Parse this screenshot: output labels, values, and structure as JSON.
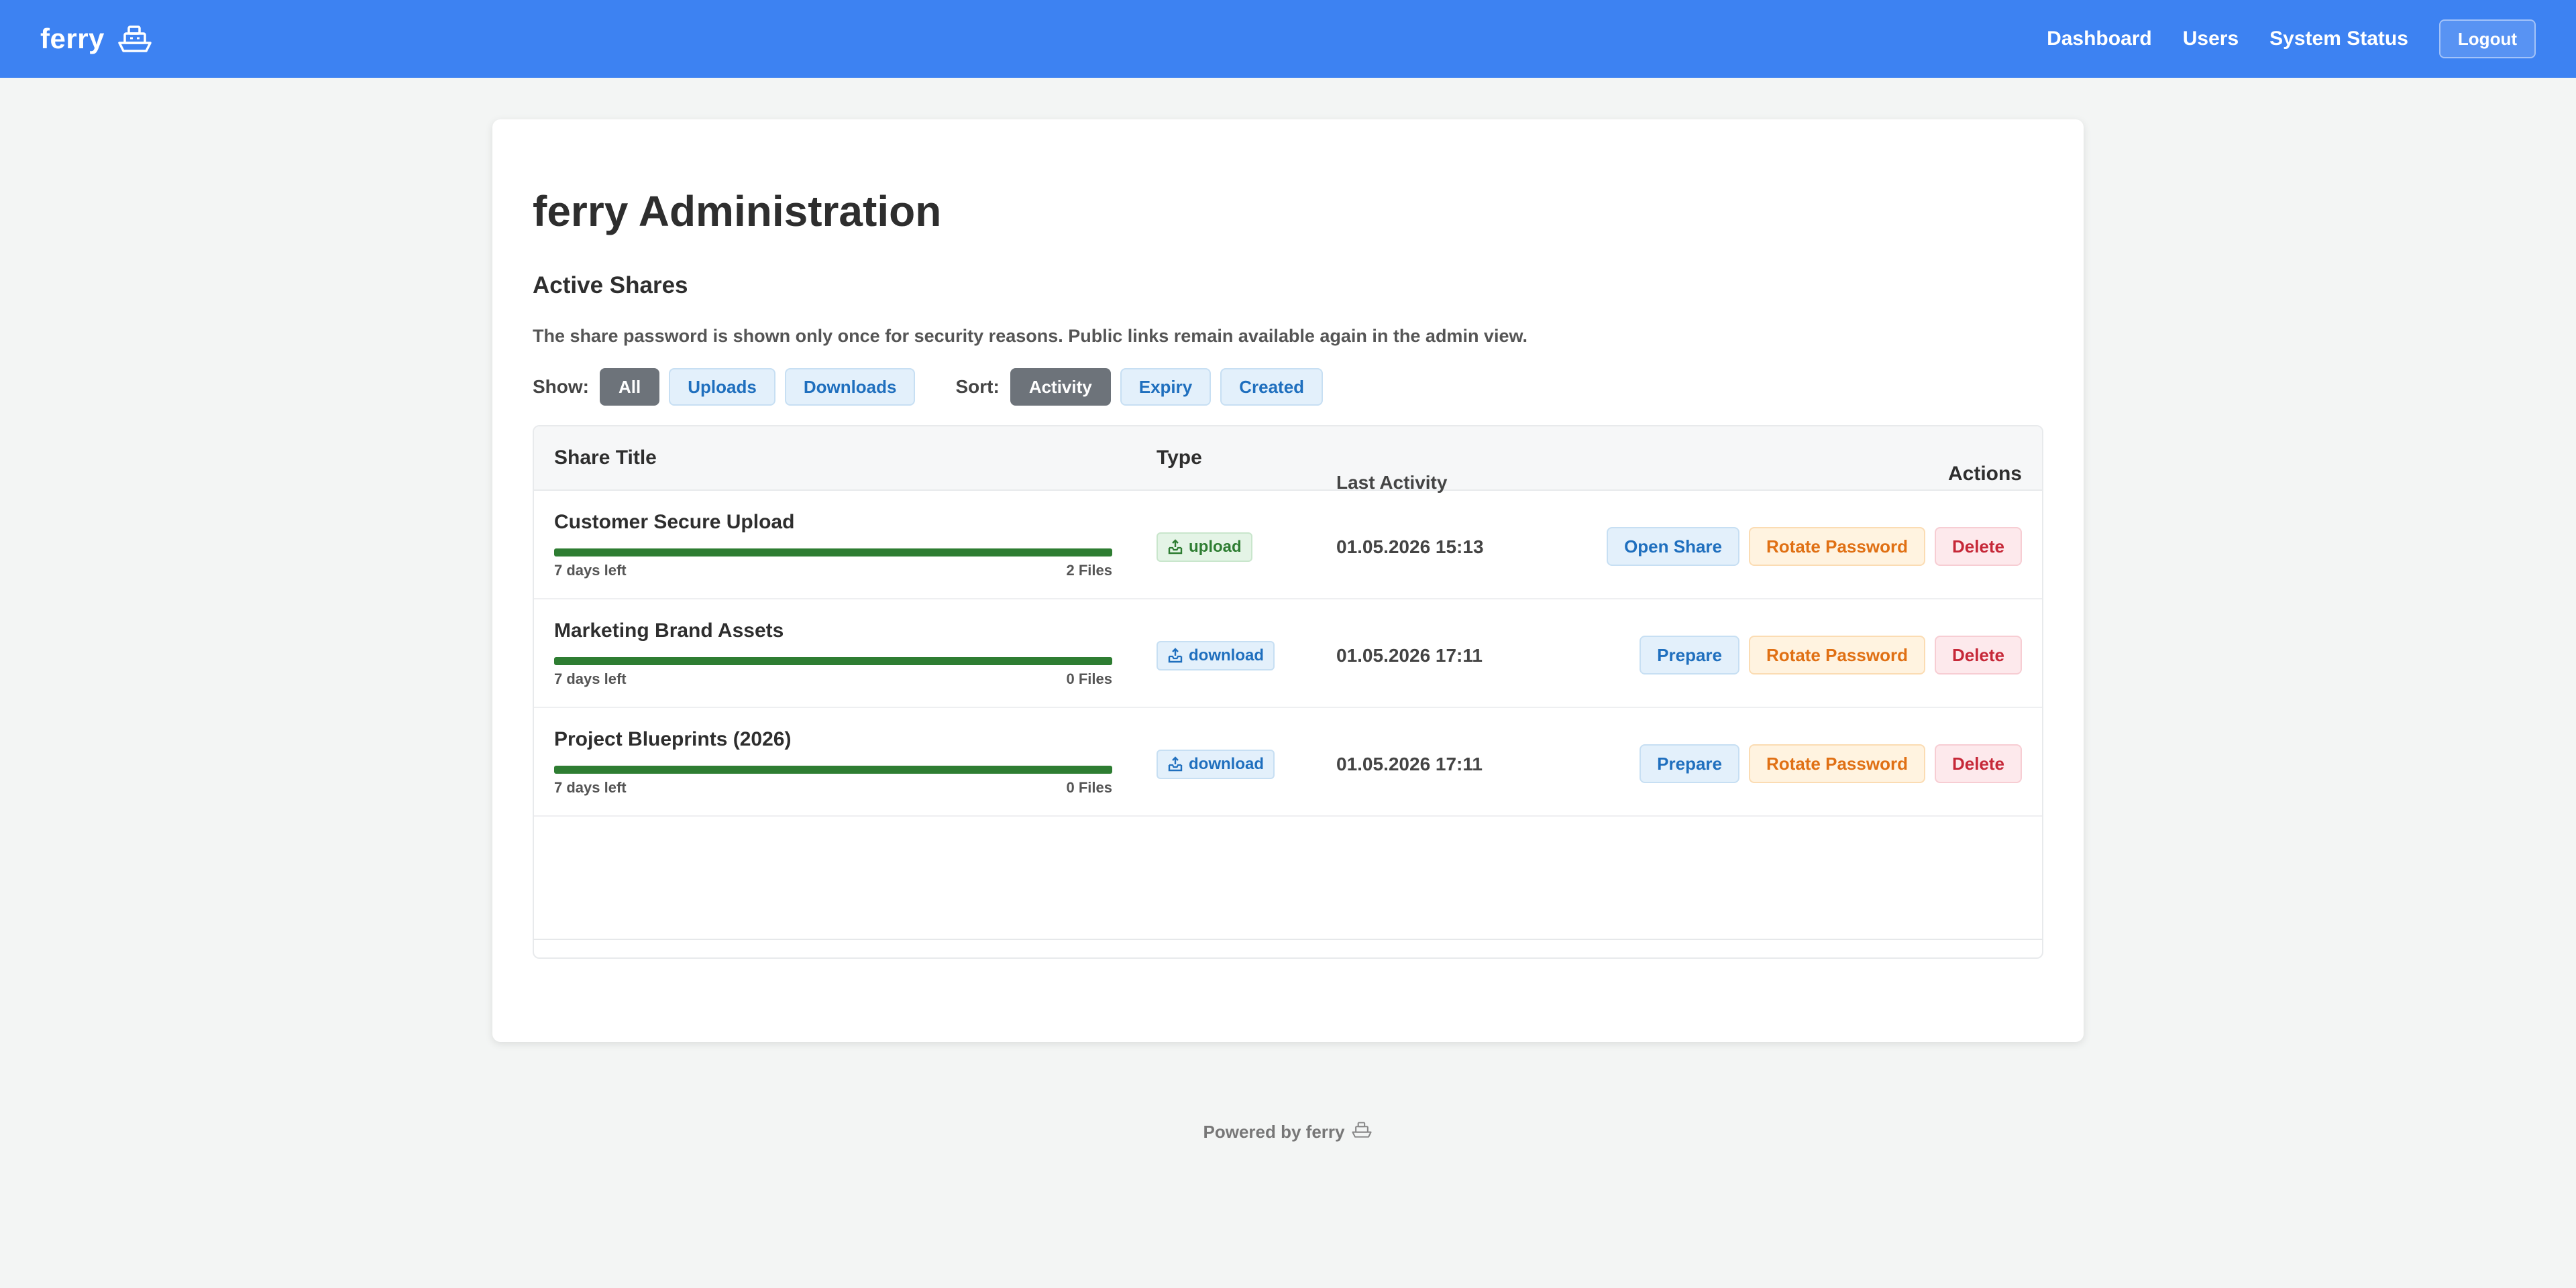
{
  "header": {
    "brand": "ferry",
    "brand_icon": "ship-icon",
    "nav": [
      {
        "label": "Dashboard"
      },
      {
        "label": "Users"
      },
      {
        "label": "System Status"
      }
    ],
    "logout_label": "Logout"
  },
  "main": {
    "title": "ferry Administration",
    "section_title": "Active Shares",
    "notice": "The share password is shown only once for security reasons. Public links remain available again in the admin view.",
    "filters": {
      "show_label": "Show:",
      "show_options": [
        "All",
        "Uploads",
        "Downloads"
      ],
      "show_active": "All",
      "sort_label": "Sort:",
      "sort_options": [
        "Activity",
        "Expiry",
        "Created"
      ],
      "sort_active": "Activity"
    },
    "table": {
      "headers": {
        "title": "Share Title",
        "type": "Type",
        "activity": "Last Activity",
        "actions": "Actions"
      },
      "rows": [
        {
          "title": "Customer Secure Upload",
          "expiry": "7 days left",
          "files": "2 Files",
          "progress": 1.0,
          "type": "upload",
          "type_icon": "upload-tray-icon",
          "last_activity": "01.05.2026 15:13",
          "primary_action": "Open Share",
          "rotate_action": "Rotate Password",
          "delete_action": "Delete"
        },
        {
          "title": "Marketing Brand Assets",
          "expiry": "7 days left",
          "files": "0 Files",
          "progress": 1.0,
          "type": "download",
          "type_icon": "download-tray-icon",
          "last_activity": "01.05.2026 17:11",
          "primary_action": "Prepare",
          "rotate_action": "Rotate Password",
          "delete_action": "Delete"
        },
        {
          "title": "Project Blueprints (2026)",
          "expiry": "7 days left",
          "files": "0 Files",
          "progress": 1.0,
          "type": "download",
          "type_icon": "download-tray-icon",
          "last_activity": "01.05.2026 17:11",
          "primary_action": "Prepare",
          "rotate_action": "Rotate Password",
          "delete_action": "Delete"
        }
      ]
    }
  },
  "footer": {
    "text": "Powered by ferry",
    "icon": "ship-icon"
  },
  "colors": {
    "header": "#3d82f2",
    "progress": "#2e7d32",
    "upload": "#2e7d32",
    "download": "#1f6fbe",
    "rotate": "#e07014",
    "delete": "#c62838"
  }
}
